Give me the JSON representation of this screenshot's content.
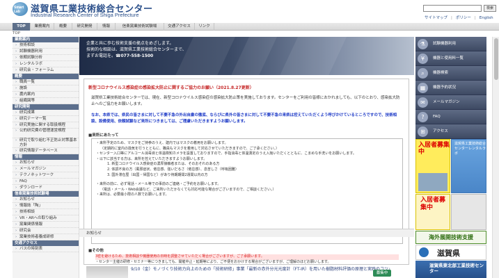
{
  "header": {
    "logo_text": "Smart Lab",
    "title_jp": "滋賀県工業技術総合センター",
    "title_en": "Industrial Research Center of Shiga Prefecture",
    "search_button": "検索",
    "links": [
      "サイトマップ",
      "ポリシー",
      "English"
    ]
  },
  "nav": {
    "tabs": [
      "TOP",
      "業務案内",
      "概要",
      "研究開発",
      "情報",
      "信楽窯業技術試験場",
      "交通アクセス",
      "リンク"
    ]
  },
  "breadcrumb": "TOP",
  "sidebar": {
    "sections": [
      {
        "title": "業務案内",
        "items": [
          "技術相談",
          "試験機器利用",
          "依頼試験分析",
          "レンタルラボ",
          "研究会・フォーラム"
        ]
      },
      {
        "title": "概要",
        "items": [
          "職員一覧",
          "施設",
          "農内案内",
          "組織図等"
        ]
      },
      {
        "title": "研究開発",
        "items": [
          "研究成果",
          "研究テーマ一覧",
          "研究実施に関する取扱規程",
          "公的研究費の管理運営規程",
          "研究で取り組む不正防止対策基本方針",
          "研究情報データベース"
        ]
      },
      {
        "title": "情報",
        "items": [
          "お知らせ",
          "メールマガジン",
          "テクノネットワーク",
          "FAQ",
          "ダウンロード"
        ]
      },
      {
        "title": "信楽窯業技術試験場",
        "items": [
          "お知らせ",
          "情報誌「陶」",
          "技術相談",
          "VR・ARへの取り組み",
          "窯業関係情報",
          "研究会",
          "窯業技術者養成研修"
        ]
      },
      {
        "title": "交通アクセス",
        "items": [
          "バスの時刻表"
        ]
      }
    ]
  },
  "banner": {
    "line1": "企業と共に歩む技術支援の拠点をめざします。",
    "line2": "技術的な相談は、滋賀県工業技術総合センターまで、",
    "line3_prefix": "まずお電話を。",
    "tel": "☎077-558-1500"
  },
  "notice": {
    "title": "新型コロナウイルス感染症の感染拡大防止に関するご協力のお願い（2021.8.27更新）",
    "intro": "滋賀県工業技術総合センターでは、現在、新型コロナウイルス感染症の感染拡大防止策を実施しております。センターをご利用の皆様におかれましても、以下のとおり、感染拡大防止へのご協力をお願いします。",
    "warning": "なお、本県では、県民の皆さまに対して不要不急の外出自粛の徹底、ならびに県外の皆さまに対して不要不急の来県は控えていただくよう呼びかけているところですので、技術相談、設備使用、依頼試験など来所につきましては、ご理慮いただきますようお願いします。",
    "section1": "■来所にあたって",
    "bullets1": [
      "・来所予定のため、マスクをご持参のうえ、建内ではマスクの着用をお願いします。",
      "（定期的に室内の換気を行うとともに、職員もマスクを着用して対応させていただきますので、ご了承ください。）",
      "・センター入口等にアルコール消毒液と体温検知カメラを設置しておりますので、手指消毒と体温測定のうえ入館いただくとともに、こまめな手洗いをお願いします。",
      "・以下に該当する方は、来所を控えていただきますようお願いします。",
      "1. 新型コロナウイルス感染症の濃厚接触者または、そのおそれのある方",
      "2. 体調不良の方（風邪症状、倦怠感、強いだるさ（倦怠感）、息苦しさ（呼吸困難）",
      "3. 国外滞在歴（出国・帰国など）があり待期期間2週間以内の方",
      "・来所の前に、必ず電話・メール等での事前のご連絡・ご予約をお願いします。",
      "（電話・メール・Web会議など、ご来所いただかなくても対応可能な場合がございますので、ご相談ください。）",
      "・来所は、必要最小限の人数でお願いします。"
    ],
    "section2": "■その他",
    "bullets2": [
      "3密を避けるため、技術相談や機器使用の日時を調整させていただく場合がございますが、ご了承願います。",
      "・センター主催の研修・セミナー等につきましても、開催中止・延期等により、ご不便をおかけする場合がございますが、ご理解のほどお願いします。"
    ]
  },
  "osirase": {
    "head": "お知らせ",
    "news_text": "9/10（金）モノづくり技術力向上のための「技術研修」事業「最新の赤外分光光度計（FT-IR）を用いた樹脂材料評価の原理と実践のコツ」",
    "badge": "募集中"
  },
  "right_menu": {
    "items": [
      {
        "icon": "microscope-icon",
        "glyph": "⚗",
        "label": "試験機器利用"
      },
      {
        "icon": "yen-icon",
        "glyph": "¥",
        "label": "機器と使用料一覧"
      },
      {
        "icon": "search-icon",
        "glyph": "⌕",
        "label": "機器検索"
      },
      {
        "icon": "calendar-icon",
        "glyph": "▦",
        "label": "機器予約状況"
      },
      {
        "icon": "mail-icon",
        "glyph": "✉",
        "label": "メールマガジン"
      },
      {
        "icon": "faq-icon",
        "glyph": "?",
        "label": "FAQ"
      },
      {
        "icon": "bus-icon",
        "glyph": "⊞",
        "label": "アクセス"
      }
    ]
  },
  "ads": {
    "ad1": "入居者募集中",
    "ad2": "滋賀県工業技術総合センターレンタルラボ",
    "ad3": "入居者募集中",
    "ad5": "海外展開技術支援",
    "ad6": "滋賀県",
    "ad7": "滋賀県東北部工業技術センター"
  }
}
